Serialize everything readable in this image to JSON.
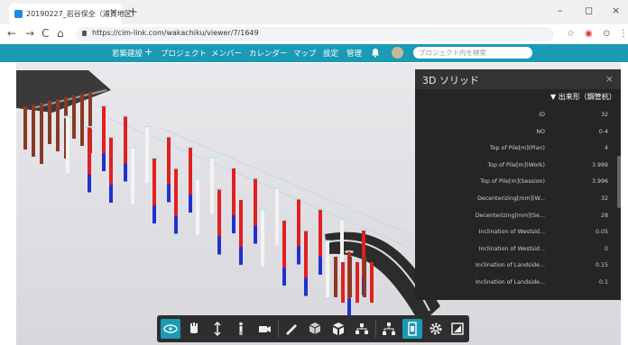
{
  "browser": {
    "tab_title": "20190227_岩谷保全（浦賀地区）",
    "tab_close": "×",
    "new_tab": "+",
    "window_controls": [
      "–",
      "◻",
      "×"
    ],
    "nav_icons": [
      "←",
      "→",
      "C",
      "⌂"
    ],
    "url": "https://cim-link.com/wakachiku/viewer/7/1649",
    "address_icons": [
      "☆",
      "◉",
      "⊙",
      "⋮"
    ]
  },
  "app_nav": {
    "brand": "若築建設",
    "plus": "+",
    "items": [
      "プロジェクト",
      "メンバー",
      "カレンダー",
      "マップ",
      "設定",
      "管理"
    ],
    "search_placeholder": "プロジェクト内を検索"
  },
  "panel": {
    "title": "3D ソリッド",
    "close": "×",
    "section": "▼ 出来形（鋼管杭）",
    "rows": [
      {
        "key": "ID",
        "value": "32"
      },
      {
        "key": "NO",
        "value": "0-4"
      },
      {
        "key": "Top of Pile[m](Plan)",
        "value": "4"
      },
      {
        "key": "Top of Pile[m](Work)",
        "value": "3.999"
      },
      {
        "key": "Top of Pile[m](Session)",
        "value": "3.996"
      },
      {
        "key": "Decenterizing[mm](W...",
        "value": "32"
      },
      {
        "key": "Decenterizing[mm](Se...",
        "value": "28"
      },
      {
        "key": "Inclination of Westsid...",
        "value": "0.05"
      },
      {
        "key": "Inclination of Westsid...",
        "value": "0"
      },
      {
        "key": "Inclination of Landside...",
        "value": "0.15"
      },
      {
        "key": "Inclination of Landside...",
        "value": "0.1"
      }
    ]
  },
  "colors": {
    "accent": "#1a9ab5",
    "pile_red": "#e02020",
    "pile_blue": "#2030d0",
    "pile_white": "#f4f4f4",
    "pile_brown": "#8a3a22"
  }
}
